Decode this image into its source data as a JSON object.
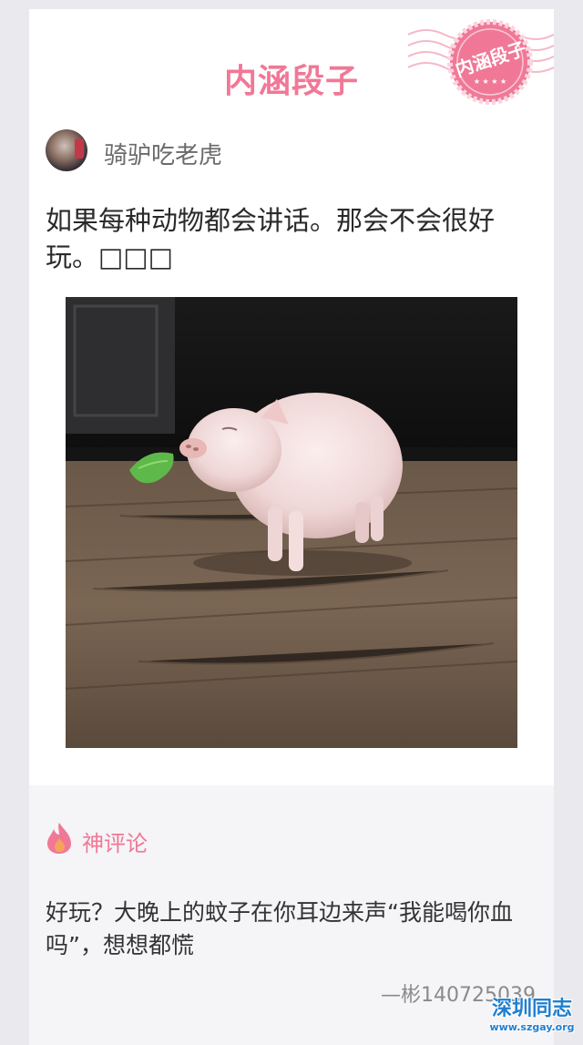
{
  "header": {
    "brand_title": "内涵段子",
    "stamp_text": "内涵段子",
    "brand_color": "#f07896"
  },
  "post": {
    "author": {
      "name": "骑驴吃老虎"
    },
    "text": "如果每种动物都会讲话。那会不会很好玩。□□□",
    "image": {
      "alt": ""
    }
  },
  "comments": {
    "heading_label": "神评论",
    "heading_icon": "fire-icon",
    "text": "好玩？大晚上的蚊子在你耳边来声“我能喝你血吗”，想想都慌",
    "signature": "—彬140725039"
  },
  "watermark": {
    "main": "深圳同志",
    "url": "www.szgay.org"
  }
}
